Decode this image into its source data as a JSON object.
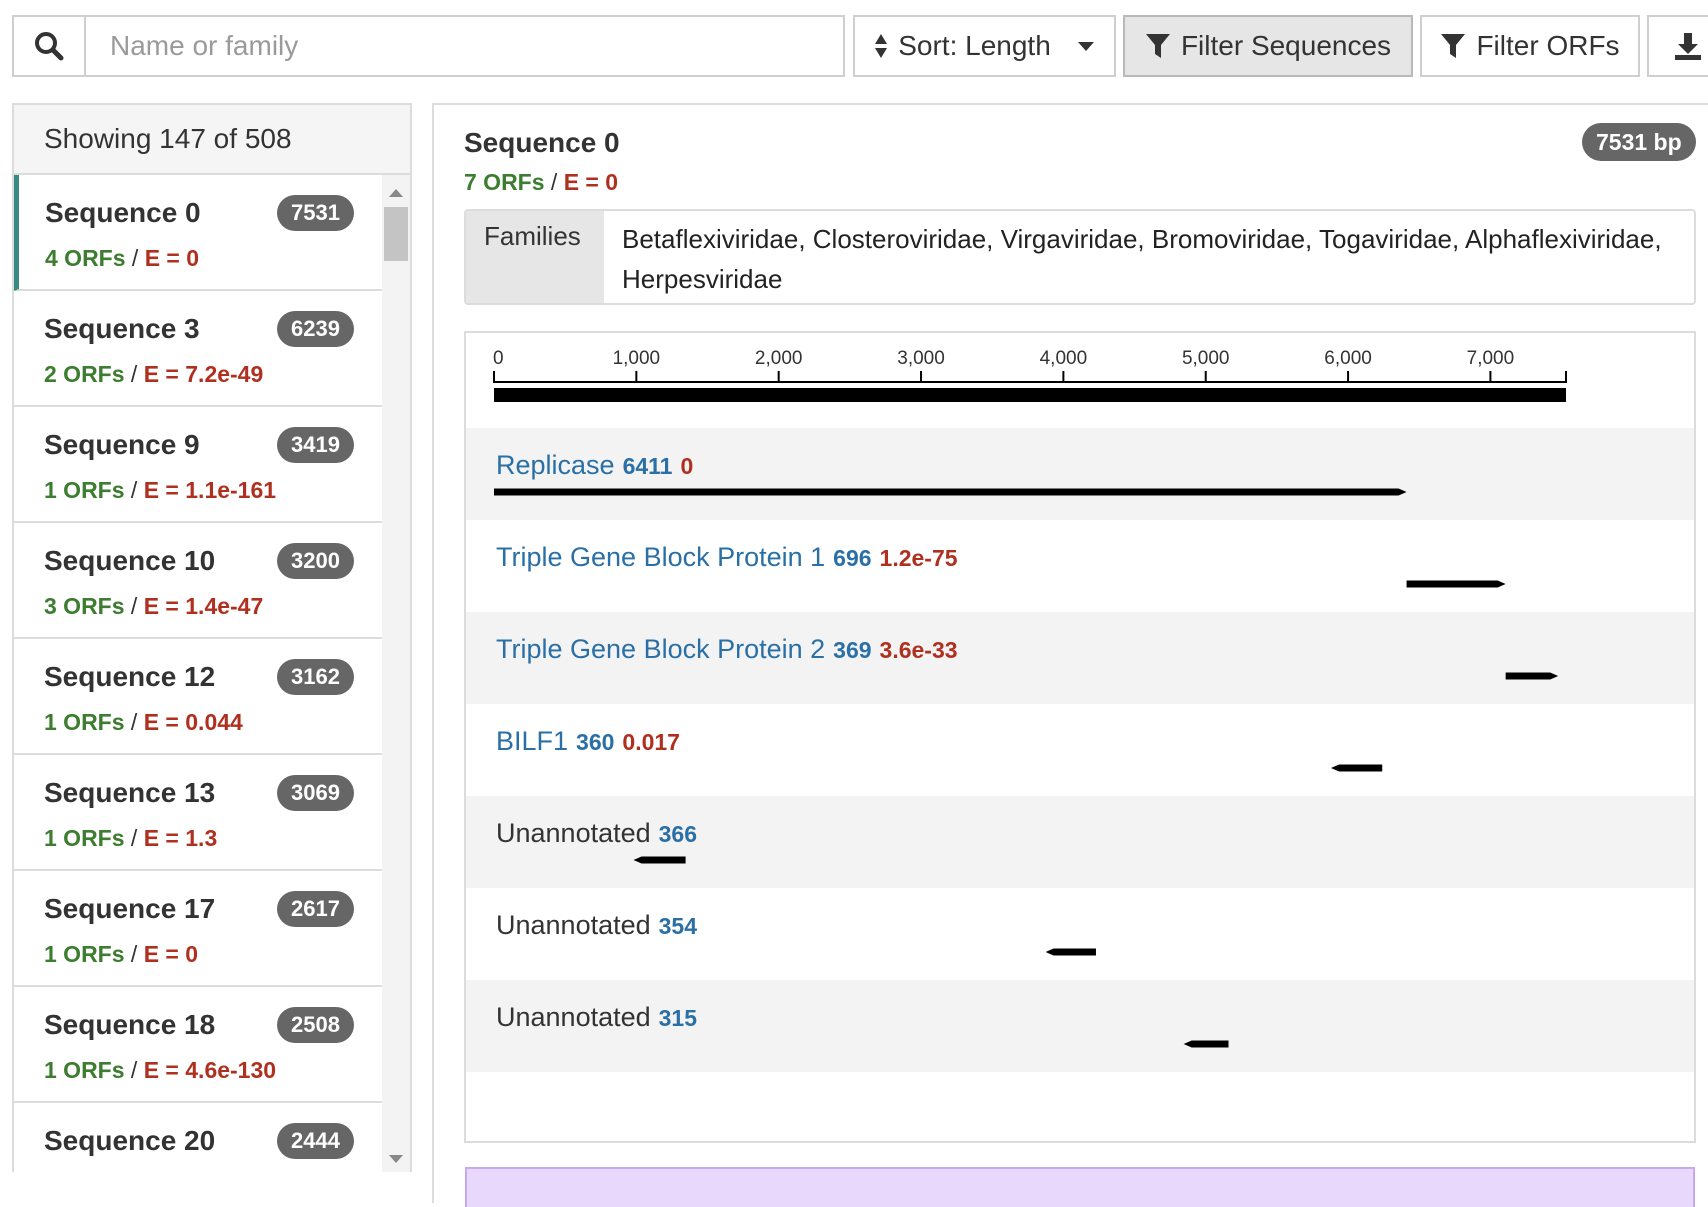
{
  "toolbar": {
    "search_icon": "search-icon",
    "search_placeholder": "Name or family",
    "sort_label": "Sort: Length",
    "filter_sequences_label": "Filter Sequences",
    "filter_orfs_label": "Filter ORFs",
    "download_icon": "download-icon"
  },
  "sidebar": {
    "showing": "Showing 147 of 508",
    "items": [
      {
        "name": "Sequence 0",
        "length": "7531",
        "orfs": "4 ORFs",
        "e": "E = 0"
      },
      {
        "name": "Sequence 3",
        "length": "6239",
        "orfs": "2 ORFs",
        "e": "E = 7.2e-49"
      },
      {
        "name": "Sequence 9",
        "length": "3419",
        "orfs": "1 ORFs",
        "e": "E = 1.1e-161"
      },
      {
        "name": "Sequence 10",
        "length": "3200",
        "orfs": "3 ORFs",
        "e": "E = 1.4e-47"
      },
      {
        "name": "Sequence 12",
        "length": "3162",
        "orfs": "1 ORFs",
        "e": "E = 0.044"
      },
      {
        "name": "Sequence 13",
        "length": "3069",
        "orfs": "1 ORFs",
        "e": "E = 1.3"
      },
      {
        "name": "Sequence 17",
        "length": "2617",
        "orfs": "1 ORFs",
        "e": "E = 0"
      },
      {
        "name": "Sequence 18",
        "length": "2508",
        "orfs": "1 ORFs",
        "e": "E = 4.6e-130"
      },
      {
        "name": "Sequence 20",
        "length": "2444",
        "orfs": "",
        "e": ""
      }
    ]
  },
  "detail": {
    "title": "Sequence 0",
    "orfs": "7 ORFs",
    "e": "E = 0",
    "length_badge": "7531 bp",
    "families_label": "Families",
    "families": "Betaflexiviridae, Closteroviridae, Virgaviridae, Bromoviridae, Togaviridae, Alphaflexiviridae, Herpesviridae",
    "sequence_length": 7531,
    "axis_ticks": [
      0,
      1000,
      2000,
      3000,
      4000,
      5000,
      6000,
      7000
    ],
    "axis_tick_labels": [
      "0",
      "1,000",
      "2,000",
      "3,000",
      "4,000",
      "5,000",
      "6,000",
      "7,000"
    ],
    "orfs_list": [
      {
        "name": "Replicase",
        "length": "6411",
        "e": "0",
        "annotated": true,
        "start": 0,
        "end": 6411,
        "strand": "+"
      },
      {
        "name": "Triple Gene Block Protein 1",
        "length": "696",
        "e": "1.2e-75",
        "annotated": true,
        "start": 6411,
        "end": 7107,
        "strand": "+"
      },
      {
        "name": "Triple Gene Block Protein 2",
        "length": "369",
        "e": "3.6e-33",
        "annotated": true,
        "start": 7107,
        "end": 7476,
        "strand": "+"
      },
      {
        "name": "BILF1",
        "length": "360",
        "e": "0.017",
        "annotated": true,
        "start": 5880,
        "end": 6240,
        "strand": "-"
      },
      {
        "name": "Unannotated",
        "length": "366",
        "e": "",
        "annotated": false,
        "start": 980,
        "end": 1346,
        "strand": "-"
      },
      {
        "name": "Unannotated",
        "length": "354",
        "e": "",
        "annotated": false,
        "start": 3875,
        "end": 4229,
        "strand": "-"
      },
      {
        "name": "Unannotated",
        "length": "315",
        "e": "",
        "annotated": false,
        "start": 4845,
        "end": 5160,
        "strand": "-"
      }
    ]
  }
}
